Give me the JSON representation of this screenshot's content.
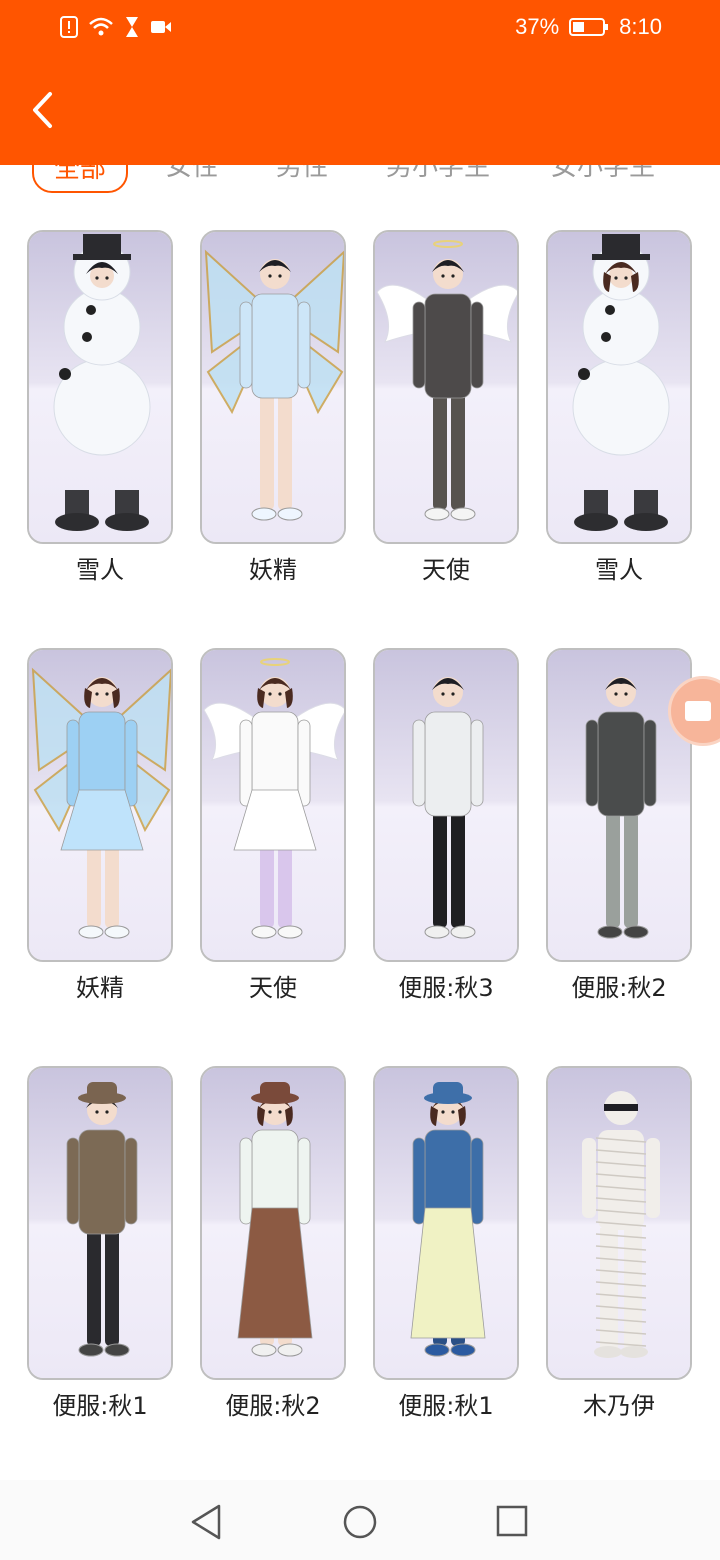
{
  "status": {
    "battery_pct": "37%",
    "time": "8:10"
  },
  "colors": {
    "accent": "#FF5500",
    "card_border": "#bfbfbf",
    "card_bg": "#efedf7"
  },
  "tabs": [
    {
      "label": "全部",
      "active": true
    },
    {
      "label": "女性",
      "active": false
    },
    {
      "label": "男性",
      "active": false
    },
    {
      "label": "男小学生",
      "active": false
    },
    {
      "label": "女小学生",
      "active": false
    }
  ],
  "costumes": [
    {
      "name": "雪人",
      "figure": "snowman-boy"
    },
    {
      "name": "妖精",
      "figure": "fairy-boy"
    },
    {
      "name": "天使",
      "figure": "angel-boy"
    },
    {
      "name": "雪人",
      "figure": "snowman-girl"
    },
    {
      "name": "妖精",
      "figure": "fairy-girl"
    },
    {
      "name": "天使",
      "figure": "angel-girl"
    },
    {
      "name": "便服:秋3",
      "figure": "casual-boy-white-jacket"
    },
    {
      "name": "便服:秋2",
      "figure": "casual-boy-gray-jacket"
    },
    {
      "name": "便服:秋1",
      "figure": "casual-boy-hat"
    },
    {
      "name": "便服:秋2",
      "figure": "casual-girl-brown-skirt"
    },
    {
      "name": "便服:秋1",
      "figure": "casual-girl-denim"
    },
    {
      "name": "木乃伊",
      "figure": "mummy-boy"
    }
  ]
}
